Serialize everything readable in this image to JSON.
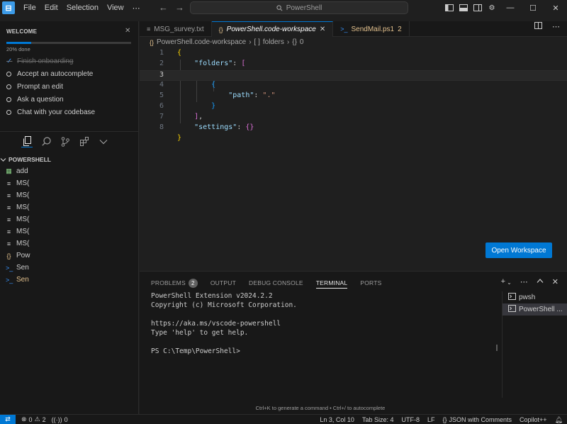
{
  "titlebar": {
    "menus": [
      "File",
      "Edit",
      "Selection",
      "View",
      "⋯"
    ],
    "search": "PowerShell"
  },
  "welcome": {
    "title": "WELCOME",
    "progress_label": "20% done",
    "progress": 0.2,
    "items": [
      {
        "label": "Finish onboarding",
        "done": true
      },
      {
        "label": "Accept an autocomplete",
        "done": false
      },
      {
        "label": "Prompt an edit",
        "done": false
      },
      {
        "label": "Ask a question",
        "done": false
      },
      {
        "label": "Chat with your codebase",
        "done": false
      }
    ]
  },
  "explorer": {
    "title": "POWERSHELL",
    "files": [
      {
        "name": "add",
        "icon": "excel-file-icon",
        "glyph": "▦",
        "color": "#89d185"
      },
      {
        "name": "MS(",
        "icon": "text-file-icon",
        "glyph": "≡",
        "color": "#cccccc"
      },
      {
        "name": "MS(",
        "icon": "text-file-icon",
        "glyph": "≡",
        "color": "#cccccc"
      },
      {
        "name": "MS(",
        "icon": "text-file-icon",
        "glyph": "≡",
        "color": "#cccccc"
      },
      {
        "name": "MS(",
        "icon": "text-file-icon",
        "glyph": "≡",
        "color": "#cccccc"
      },
      {
        "name": "MS(",
        "icon": "text-file-icon",
        "glyph": "≡",
        "color": "#cccccc"
      },
      {
        "name": "MS(",
        "icon": "text-file-icon",
        "glyph": "≡",
        "color": "#cccccc"
      },
      {
        "name": "Pow",
        "icon": "json-file-icon",
        "glyph": "{}",
        "color": "#e2c08d"
      },
      {
        "name": "Sen",
        "icon": "powershell-file-icon",
        "glyph": ">_",
        "color": "#3794ff"
      },
      {
        "name": "Sen",
        "icon": "powershell-file-icon",
        "glyph": ">_",
        "color": "#3794ff",
        "modified": true
      }
    ]
  },
  "tabs": [
    {
      "label": "MSG_survey.txt",
      "glyph": "≡",
      "active": false
    },
    {
      "label": "PowerShell.code-workspace",
      "glyph": "{}",
      "active": true
    },
    {
      "label": "SendMail.ps1",
      "glyph": ">_",
      "active": false,
      "badge": "2"
    }
  ],
  "breadcrumb": [
    "PowerShell.code-workspace",
    "folders",
    "0"
  ],
  "editor": {
    "current_line": 3,
    "line_numbers": [
      "1",
      "2",
      "3",
      "4",
      "5",
      "6",
      "7",
      "8"
    ],
    "tok": {
      "lbrace": "{",
      "rbrace": "}",
      "folders_key": "\"folders\"",
      "colon": ": ",
      "lbracket": "[",
      "rbracket": "]",
      "path_key": "\"path\"",
      "path_val": "\".\"",
      "comma": ",",
      "settings_key": "\"settings\"",
      "empty_obj": "{}"
    }
  },
  "open_workspace_label": "Open Workspace",
  "panel": {
    "tabs": [
      {
        "label": "PROBLEMS",
        "badge": "2"
      },
      {
        "label": "OUTPUT"
      },
      {
        "label": "DEBUG CONSOLE"
      },
      {
        "label": "TERMINAL",
        "active": true
      },
      {
        "label": "PORTS"
      }
    ],
    "terminal_output": "PowerShell Extension v2024.2.2\nCopyright (c) Microsoft Corporation.\n\nhttps://aka.ms/vscode-powershell\nType 'help' to get help.\n\nPS C:\\Temp\\PowerShell>",
    "terminals": [
      {
        "label": "pwsh",
        "selected": false
      },
      {
        "label": "PowerShell ...",
        "selected": true
      }
    ],
    "hint": "Ctrl+K to generate a command • Ctrl+/ to autocomplete"
  },
  "statusbar": {
    "errors": "0",
    "warnings": "2",
    "ports": "0",
    "position": "Ln 3, Col 10",
    "tab_size": "Tab Size: 4",
    "encoding": "UTF-8",
    "eol": "LF",
    "language": "JSON with Comments",
    "copilot": "Copilot++"
  },
  "colors": {
    "accent": "#0078d4",
    "background": "#1f1f1f",
    "sidebar": "#181818"
  }
}
